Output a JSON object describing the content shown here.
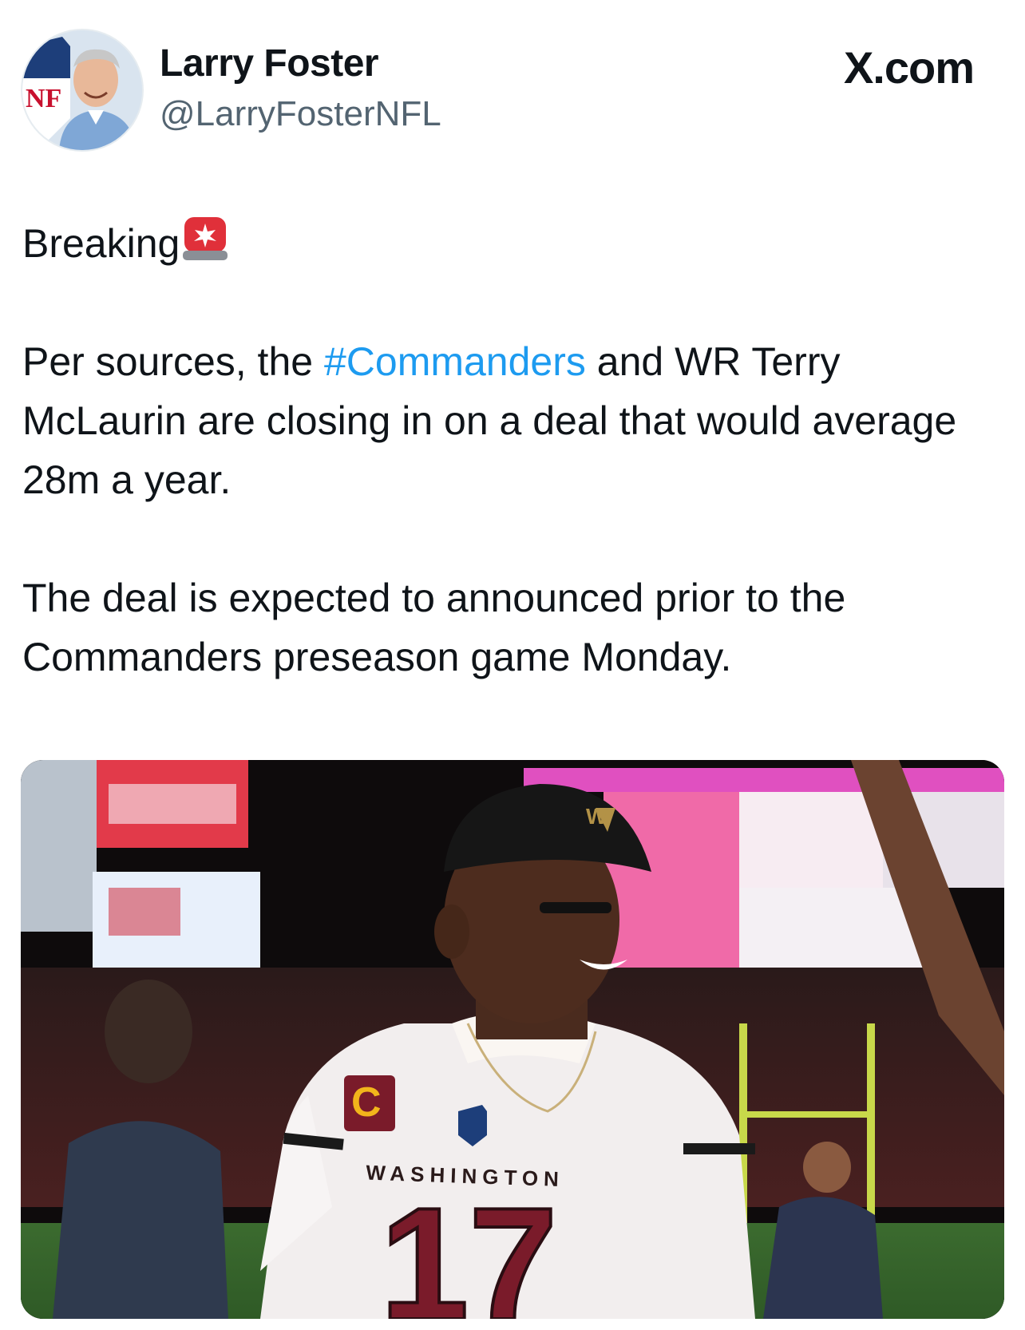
{
  "tweet": {
    "author": {
      "display_name": "Larry Foster",
      "handle": "@LarryFosterNFL",
      "avatar_icon": "profile-avatar-icon"
    },
    "source_label": "X.com",
    "lines": {
      "breaking": "Breaking",
      "siren_icon": "rotating-light-emoji",
      "p1_before": "Per sources, the ",
      "p1_hashtag": "#Commanders",
      "p1_after": " and WR Terry McLaurin are closing in on a deal that would average 28m a year.",
      "p2": "The deal is expected to announced prior to the Commanders preseason game Monday."
    },
    "media": {
      "jersey_text": "WASHINGTON",
      "jersey_number": "17",
      "captain_patch": "C",
      "headwear_logo": "W"
    }
  },
  "colors": {
    "text": "#0f1419",
    "secondary": "#536471",
    "hashtag": "#1d9bf0",
    "jersey_burgundy": "#7a1b2a",
    "captain_gold": "#f2b51b"
  }
}
